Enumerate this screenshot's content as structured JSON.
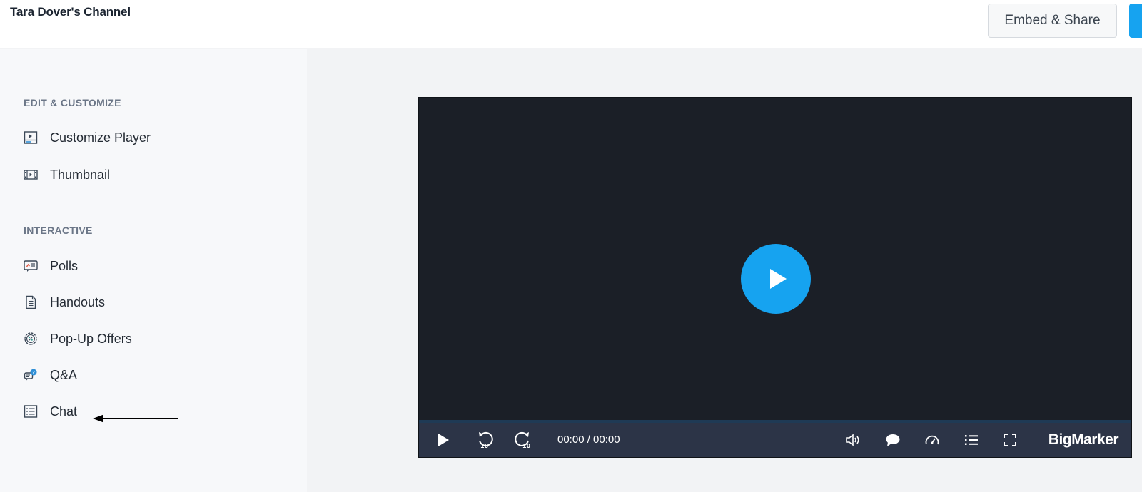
{
  "header": {
    "channel_title": "Tara Dover's Channel",
    "embed_share_label": "Embed & Share"
  },
  "sidebar": {
    "sections": [
      {
        "title": "EDIT & CUSTOMIZE",
        "items": [
          {
            "label": "Customize Player",
            "icon": "player-icon"
          },
          {
            "label": "Thumbnail",
            "icon": "film-icon"
          }
        ]
      },
      {
        "title": "INTERACTIVE",
        "items": [
          {
            "label": "Polls",
            "icon": "poll-icon"
          },
          {
            "label": "Handouts",
            "icon": "document-icon"
          },
          {
            "label": "Pop-Up Offers",
            "icon": "offer-icon"
          },
          {
            "label": "Q&A",
            "icon": "qa-icon"
          },
          {
            "label": "Chat",
            "icon": "chat-list-icon"
          }
        ]
      }
    ]
  },
  "player": {
    "time_display": "00:00 / 00:00",
    "brand": "BigMarker",
    "progress": 0
  },
  "colors": {
    "accent": "#16a3f0",
    "player_bg": "#1b1f27",
    "controls_bg": "#2c3447"
  }
}
